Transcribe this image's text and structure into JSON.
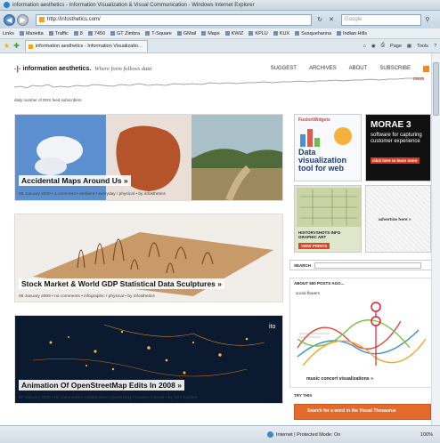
{
  "window": {
    "title": "information aesthetics - Information Visualization & Visual Communication - Windows Internet Explorer"
  },
  "address_bar": {
    "url": "http://infosthetics.com/",
    "search_placeholder": "Google"
  },
  "links_bar": {
    "label": "Links",
    "items": [
      "Marietta",
      "Traffic",
      "8",
      "7450",
      "GT Zimbra",
      "T-Square",
      "GMail",
      "Maps",
      "KWIZ",
      "KPLU",
      "KUX",
      "Susquehanna",
      "Indian Hills"
    ]
  },
  "tab": {
    "title": "information aesthetics - Information Visualizatio..."
  },
  "command_bar": {
    "page": "Page",
    "tools": "Tools"
  },
  "site": {
    "logo": "information aesthetics.",
    "tagline": "Where form follows data",
    "nav": [
      "SUGGEST",
      "ARCHIVES",
      "ABOUT",
      "SUBSCRIBE"
    ],
    "rss_label": "daily number of RSS feed subscribers",
    "rss_count": "23815"
  },
  "posts": [
    {
      "title": "Accidental Maps Around Us »",
      "meta": "08 January 2009 • 1 comment • ambient / everyday / physical • by infosthetics"
    },
    {
      "title": "Stock Market & World GDP Statistical Data Sculptures »",
      "meta": "08 January 2009 • no comments • infographic / physical • by infosthetics"
    },
    {
      "title": "Animation Of OpenStreetMap Edits In 2008 »",
      "meta": "07 January 2009 • no comments • collaborative / guest blog / locative / movie • by Tom Carden"
    }
  ],
  "sidebar": {
    "ad1_title": "Data visualization tool for web",
    "ad1_brand": "FusionWidgets",
    "ad2_title": "MORAE 3",
    "ad2_text": "software for capturing customer experience",
    "ad2_cta": "click here to learn more",
    "ad3_label": "HISTORYSHOTS INFO GRAPHIC ART",
    "ad3_cta": "VIEW PRINTS",
    "ad4_label": "advertise here »",
    "search_label": "SEARCH",
    "about_label": "ABOUT 500 POSTS AGO...",
    "about_caption": "music concert visualizations »",
    "about_small": "social flowers",
    "try_label": "TRY THIS",
    "try_text": "Search for a word in the Visual Thesaurus"
  },
  "status_bar": {
    "zone": "Internet | Protected Mode: On",
    "zoom": "100%"
  }
}
